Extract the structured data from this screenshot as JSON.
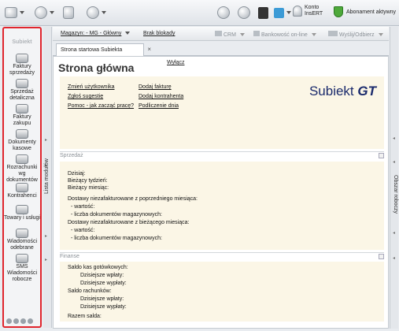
{
  "topbar": {
    "konto_line1": "Konto",
    "konto_line2": "InsERT",
    "abonament": "Abonament aktywny"
  },
  "sidebar": {
    "header": "Subiekt",
    "items": [
      {
        "label": "Faktury sprzedaży"
      },
      {
        "label": "Sprzedaż detaliczna"
      },
      {
        "label": "Faktury zakupu"
      },
      {
        "label": "Dokumenty kasowe"
      },
      {
        "label": "Rozrachunki wg dokumentów"
      },
      {
        "label": "Kontrahenci"
      },
      {
        "label": "Towary i usługi"
      },
      {
        "label": "Wiadomości odebrane"
      },
      {
        "label": "SMS Wiadomości robocze"
      }
    ]
  },
  "left_panel_label": "Lista modułów",
  "right_panel_label": "Obszar roboczy",
  "toolbar": {
    "magazyn": "Magazyn: - MG - Główny",
    "brak_blokady": "Brak blokady",
    "crm": "CRM",
    "bankowosc": "Bankowość on-line",
    "wyslij": "Wyślij/Odbierz"
  },
  "tab": {
    "label": "Strona startowa Subiekta"
  },
  "page": {
    "title": "Strona główna",
    "wyloguj": "Wyłącz",
    "links_left": [
      "Zmień użytkownika",
      "Zgłoś sugestię",
      "Pomoc - jak zacząć pracę?"
    ],
    "links_right": [
      "Dodaj fakturę",
      "Dodaj kontrahenta",
      "Podliczenie dnia"
    ],
    "logo_text": "Subiekt",
    "logo_suffix": "GT"
  },
  "sprzedaz": {
    "title": "Sprzedaż",
    "lines": [
      "Dzisiaj:",
      "Bieżący tydzień:",
      "Bieżący miesiąc:",
      "",
      "Dostawy niezafakturowane z poprzedniego miesiąca:",
      "- wartość:",
      "- liczba dokumentów magazynowych:",
      "Dostawy niezafakturowane z bieżącego miesiąca:",
      "- wartość:",
      "- liczba dokumentów magazynowych:"
    ]
  },
  "finanse": {
    "title": "Finanse",
    "saldo_kas": "Saldo kas gotówkowych:",
    "wplaty1": "Dzisiejsze wpłaty:",
    "wyplaty1": "Dzisiejsze wypłaty:",
    "saldo_rach": "Saldo rachunków:",
    "wplaty2": "Dzisiejsze wpłaty:",
    "wyplaty2": "Dzisiejsze wypłaty:",
    "razem": "Razem salda:"
  }
}
